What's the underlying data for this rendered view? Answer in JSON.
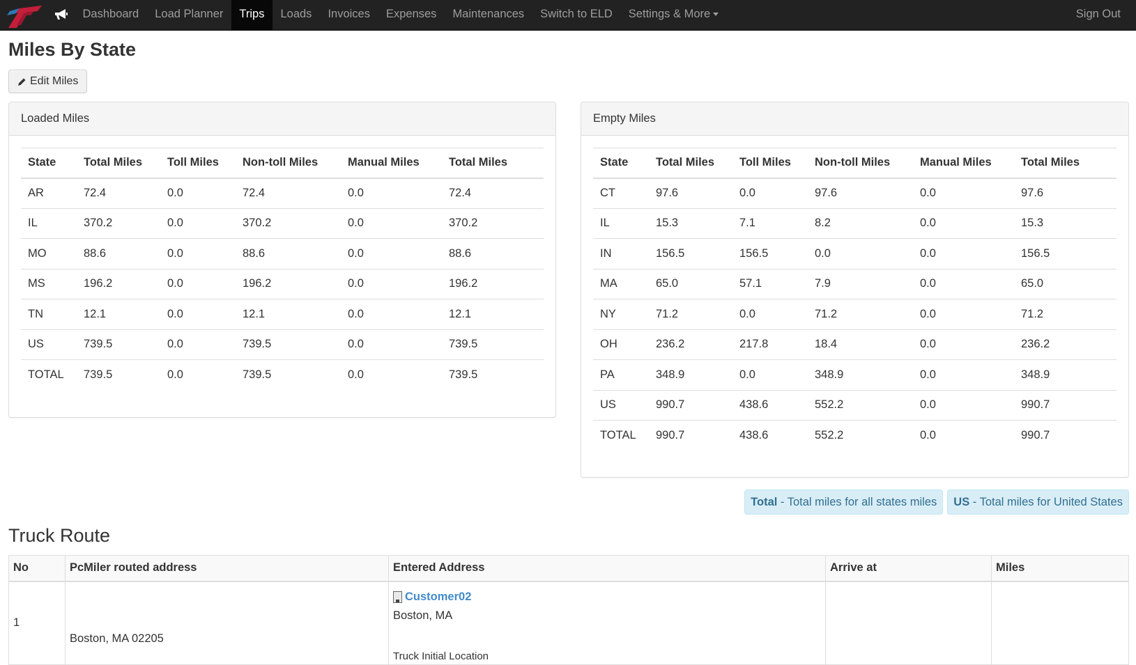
{
  "navbar": {
    "brand_icon": "company-logo",
    "announce_icon": "megaphone-icon",
    "items": [
      {
        "label": "Dashboard",
        "active": false
      },
      {
        "label": "Load Planner",
        "active": false
      },
      {
        "label": "Trips",
        "active": true
      },
      {
        "label": "Loads",
        "active": false
      },
      {
        "label": "Invoices",
        "active": false
      },
      {
        "label": "Expenses",
        "active": false
      },
      {
        "label": "Maintenances",
        "active": false
      },
      {
        "label": "Switch to ELD",
        "active": false
      },
      {
        "label": "Settings & More",
        "active": false,
        "dropdown": true
      }
    ],
    "sign_out": "Sign Out"
  },
  "page": {
    "title": "Miles By State",
    "edit_button": "Edit Miles",
    "edit_icon": "pencil-icon"
  },
  "loaded_miles": {
    "heading": "Loaded Miles",
    "columns": [
      "State",
      "Total Miles",
      "Toll Miles",
      "Non-toll Miles",
      "Manual Miles",
      "Total Miles"
    ],
    "rows": [
      [
        "AR",
        "72.4",
        "0.0",
        "72.4",
        "0.0",
        "72.4"
      ],
      [
        "IL",
        "370.2",
        "0.0",
        "370.2",
        "0.0",
        "370.2"
      ],
      [
        "MO",
        "88.6",
        "0.0",
        "88.6",
        "0.0",
        "88.6"
      ],
      [
        "MS",
        "196.2",
        "0.0",
        "196.2",
        "0.0",
        "196.2"
      ],
      [
        "TN",
        "12.1",
        "0.0",
        "12.1",
        "0.0",
        "12.1"
      ],
      [
        "US",
        "739.5",
        "0.0",
        "739.5",
        "0.0",
        "739.5"
      ],
      [
        "TOTAL",
        "739.5",
        "0.0",
        "739.5",
        "0.0",
        "739.5"
      ]
    ]
  },
  "empty_miles": {
    "heading": "Empty Miles",
    "columns": [
      "State",
      "Total Miles",
      "Toll Miles",
      "Non-toll Miles",
      "Manual Miles",
      "Total Miles"
    ],
    "rows": [
      [
        "CT",
        "97.6",
        "0.0",
        "97.6",
        "0.0",
        "97.6"
      ],
      [
        "IL",
        "15.3",
        "7.1",
        "8.2",
        "0.0",
        "15.3"
      ],
      [
        "IN",
        "156.5",
        "156.5",
        "0.0",
        "0.0",
        "156.5"
      ],
      [
        "MA",
        "65.0",
        "57.1",
        "7.9",
        "0.0",
        "65.0"
      ],
      [
        "NY",
        "71.2",
        "0.0",
        "71.2",
        "0.0",
        "71.2"
      ],
      [
        "OH",
        "236.2",
        "217.8",
        "18.4",
        "0.0",
        "236.2"
      ],
      [
        "PA",
        "348.9",
        "0.0",
        "348.9",
        "0.0",
        "348.9"
      ],
      [
        "US",
        "990.7",
        "438.6",
        "552.2",
        "0.0",
        "990.7"
      ],
      [
        "TOTAL",
        "990.7",
        "438.6",
        "552.2",
        "0.0",
        "990.7"
      ]
    ]
  },
  "legend": [
    {
      "key": "Total",
      "text": " - Total miles for all states miles"
    },
    {
      "key": "US",
      "text": " - Total miles for United States"
    }
  ],
  "colors": {
    "navbar_bg": "#222222",
    "nav_active_bg": "#080808",
    "link": "#428bca",
    "info_bg": "#d9edf7",
    "info_text": "#31708f"
  },
  "truck_route": {
    "title": "Truck Route",
    "columns": [
      "No",
      "PcMiler routed address",
      "Entered Address",
      "Arrive at",
      "Miles"
    ],
    "rows": [
      {
        "no": "1",
        "routed_address": "Boston, MA 02205",
        "entered_name": "Customer02",
        "entered_icon": "building-icon",
        "entered_city": "Boston, MA",
        "entered_note": "Truck Initial Location",
        "arrive_at": "",
        "miles": ""
      }
    ]
  }
}
